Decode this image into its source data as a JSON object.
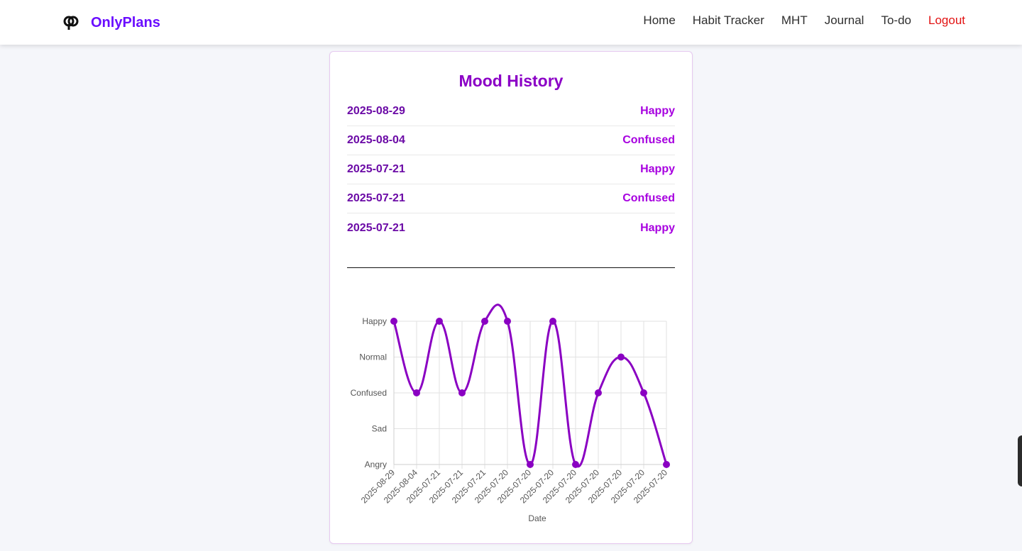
{
  "app": {
    "name": "OnlyPlans"
  },
  "nav": [
    {
      "label": "Home"
    },
    {
      "label": "Habit Tracker"
    },
    {
      "label": "MHT"
    },
    {
      "label": "Journal"
    },
    {
      "label": "To-do"
    },
    {
      "label": "Logout"
    }
  ],
  "colors": {
    "brand": "#6a0dff",
    "accent": "#8b00c6",
    "line": "#8a00c2",
    "logout": "#e21313"
  },
  "mood_history": {
    "title": "Mood History",
    "entries": [
      {
        "date": "2025-08-29",
        "mood": "Happy"
      },
      {
        "date": "2025-08-04",
        "mood": "Confused"
      },
      {
        "date": "2025-07-21",
        "mood": "Happy"
      },
      {
        "date": "2025-07-21",
        "mood": "Confused"
      },
      {
        "date": "2025-07-21",
        "mood": "Happy"
      }
    ]
  },
  "chart_data": {
    "type": "line",
    "xlabel": "Date",
    "ylabel": "",
    "y_categories": [
      "Angry",
      "Sad",
      "Confused",
      "Normal",
      "Happy"
    ],
    "x": [
      "2025-08-29",
      "2025-08-04",
      "2025-07-21",
      "2025-07-21",
      "2025-07-21",
      "2025-07-20",
      "2025-07-20",
      "2025-07-20",
      "2025-07-20",
      "2025-07-20",
      "2025-07-20",
      "2025-07-20",
      "2025-07-20"
    ],
    "values": [
      "Happy",
      "Confused",
      "Happy",
      "Confused",
      "Happy",
      "Happy",
      "Angry",
      "Happy",
      "Angry",
      "Confused",
      "Normal",
      "Confused",
      "Angry"
    ],
    "grid": true,
    "legend": "none"
  },
  "icons": {
    "brand": "brand-logo-icon"
  }
}
